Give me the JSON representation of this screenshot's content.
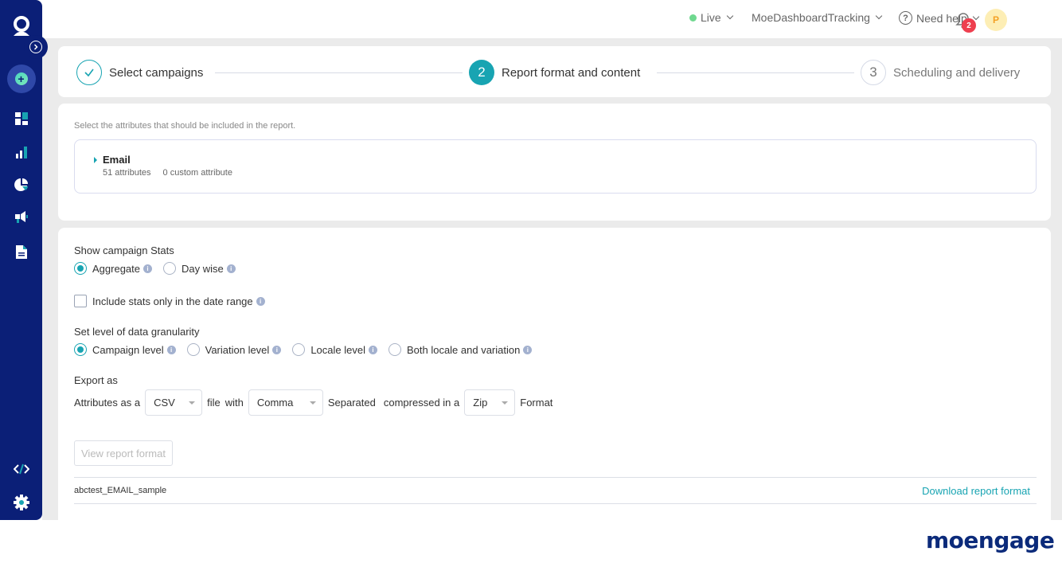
{
  "sidebar": {
    "items": [
      {
        "name": "profile",
        "icon": "user-icon"
      },
      {
        "name": "create",
        "icon": "plus-icon"
      },
      {
        "name": "dashboard",
        "icon": "dashboard-icon"
      },
      {
        "name": "analytics",
        "icon": "bar-chart-icon"
      },
      {
        "name": "segments",
        "icon": "pie-chart-icon"
      },
      {
        "name": "campaigns",
        "icon": "megaphone-icon"
      },
      {
        "name": "reports",
        "icon": "document-icon"
      },
      {
        "name": "developer",
        "icon": "code-icon"
      },
      {
        "name": "settings",
        "icon": "gear-icon"
      }
    ],
    "colors": {
      "bg": "#0b1f77",
      "accent": "#18a4b2"
    }
  },
  "topbar": {
    "env_label": "Live",
    "env_status_color": "#6fd88f",
    "workspace": "MoeDashboardTracking",
    "help_label": "Need help",
    "notification_count": "2",
    "avatar_initial": "P"
  },
  "stepper": {
    "steps": [
      {
        "number": "1",
        "label": "Select campaigns",
        "state": "done"
      },
      {
        "number": "2",
        "label": "Report format and content",
        "state": "active"
      },
      {
        "number": "3",
        "label": "Scheduling and delivery",
        "state": "pending"
      }
    ]
  },
  "attributes": {
    "hint": "Select the attributes that should be included in the report.",
    "group": {
      "title": "Email",
      "count_label": "51 attributes",
      "custom_label": "0 custom attribute"
    }
  },
  "options": {
    "stats": {
      "label": "Show campaign Stats",
      "choices": [
        {
          "label": "Aggregate",
          "selected": true
        },
        {
          "label": "Day wise",
          "selected": false
        }
      ]
    },
    "date_range": {
      "label": "Include stats only in the date range",
      "checked": false
    },
    "granularity": {
      "label": "Set level of data granularity",
      "choices": [
        {
          "label": "Campaign level",
          "selected": true
        },
        {
          "label": "Variation level",
          "selected": false
        },
        {
          "label": "Locale level",
          "selected": false
        },
        {
          "label": "Both locale and variation",
          "selected": false
        }
      ]
    },
    "export": {
      "label": "Export as",
      "prefix": "Attributes as a",
      "file_type": "CSV",
      "mid1": "file",
      "mid2": "with",
      "separator": "Comma",
      "mid3": "Separated",
      "mid4": "compressed in a",
      "compression": "Zip",
      "suffix": "Format"
    },
    "view_button": "View report format",
    "file_name": "abctest_EMAIL_sample",
    "download_link": "Download report format"
  },
  "brand": {
    "name": "moengage"
  }
}
